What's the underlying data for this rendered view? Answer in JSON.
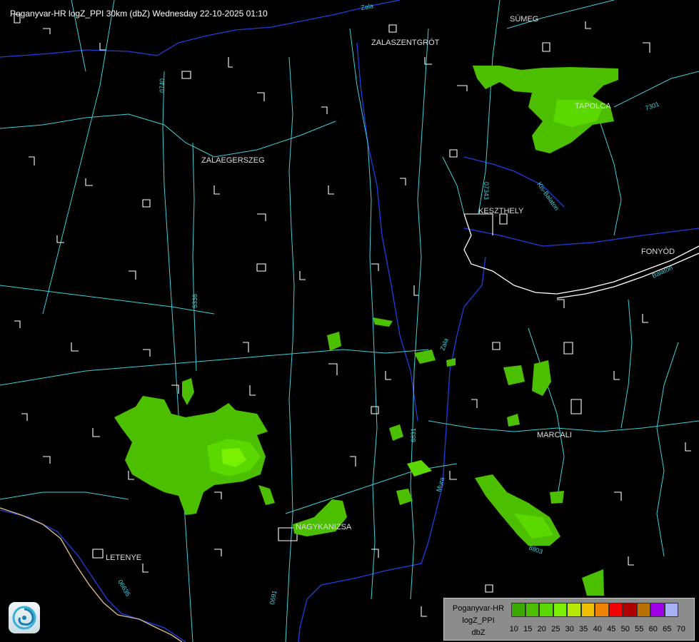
{
  "title": "Poganyvar-HR logZ_PPI 30km (dbZ) Wednesday 22-10-2025 01:10",
  "towns": [
    "SÜMEG",
    "ZALASZENTGRÓT",
    "ZALAEGERSZEG",
    "KESZTHELY",
    "FONYÓD",
    "MARCALI",
    "NAGYKANIZSA",
    "LETENYE",
    "TAPOLCA"
  ],
  "road_numbers": [
    "0740",
    "07343",
    "5336",
    "6831",
    "0691",
    "06635",
    "7301",
    "Zala",
    "Principális",
    "Balaton",
    "Kis-Balaton",
    "Boye",
    "Mura",
    "Zala",
    "8803"
  ],
  "legend": {
    "line1": "Poganyvar-HR",
    "line2": "logZ_PPI",
    "line3": "dbZ",
    "colors": [
      "#3aa800",
      "#4cc000",
      "#5ad800",
      "#78f000",
      "#b6e800",
      "#f0c000",
      "#f08000",
      "#f00000",
      "#b00000",
      "#b87000",
      "#a000e8",
      "#a8b0f8"
    ],
    "ticks": [
      "10",
      "15",
      "20",
      "25",
      "30",
      "35",
      "40",
      "45",
      "50",
      "55",
      "60",
      "65",
      "70"
    ]
  },
  "colors": {
    "echo_weak": "#4cc000",
    "echo_mid": "#5ad800",
    "echo_core": "#78f000",
    "roads": "#3fd0d8",
    "rivers": "#1f3fe0",
    "border": "#d8b888",
    "settlements": "#ffffff"
  }
}
